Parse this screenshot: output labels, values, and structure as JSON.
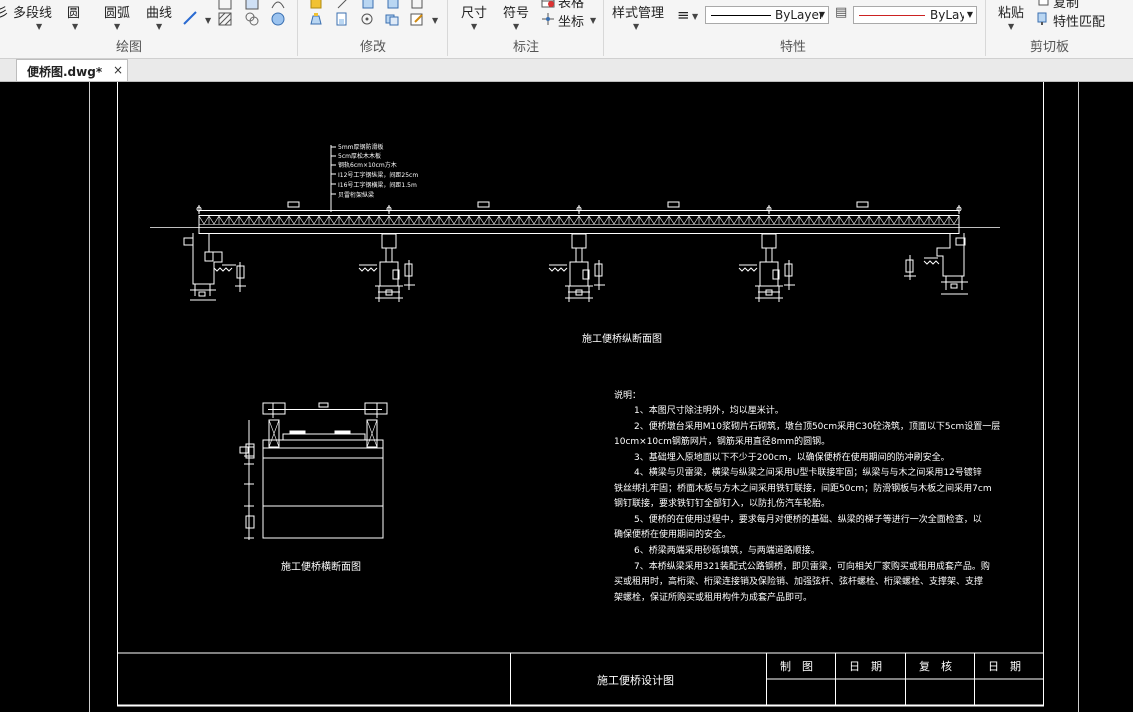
{
  "ribbon": {
    "draw_group": {
      "label": "绘图",
      "partial_char": "彡",
      "polyline": "多段线",
      "circle": "圆",
      "arc": "圆弧",
      "curve": "曲线"
    },
    "modify_group": {
      "label": "修改"
    },
    "annotate_group": {
      "label": "标注",
      "dimension": "尺寸",
      "symbol": "符号",
      "table": "表格",
      "coordinate": "坐标"
    },
    "properties_group": {
      "label": "特性",
      "style_manage": "样式管理",
      "linetype_value": "ByLayer",
      "color_value": "ByLayе",
      "lineweight_color": "#cc2222"
    },
    "clipboard_group": {
      "label": "剪切板",
      "paste": "粘贴",
      "copy": "复制",
      "match_properties": "特性匹配"
    }
  },
  "tabs": [
    {
      "label": "便桥图.dwg*",
      "close": "×"
    }
  ],
  "drawing": {
    "longitudinal_title": "施工便桥纵断面图",
    "cross_title": "施工便桥横断面图",
    "legend_lines": [
      "5mm厚钢防滑板",
      "5cm厚松木木板",
      "钢轨6cm×10cm方木",
      "I12号工字钢纵梁，间距25cm",
      "I16号工字钢横梁，间距1.5m",
      "贝雷桁架纵梁"
    ],
    "notes_title": "说明：",
    "notes": [
      "1、本图尺寸除注明外，均以厘米计。",
      "2、便桥墩台采用M10浆砌片石砌筑，墩台顶50cm采用C30砼浇筑，顶面以下5cm设置一层",
      "10cm×10cm钢筋网片，钢筋采用直径8mm的圆钢。",
      "3、基础埋入原地面以下不少于200cm，以确保便桥在使用期间的防冲刷安全。",
      "4、横梁与贝雷梁，横梁与纵梁之间采用U型卡联接牢固；纵梁与与木之间采用12号镀锌",
      "铁丝绑扎牢固；桥面木板与方木之间采用铁钉联接，间距50cm；防滑钢板与木板之间采用7cm",
      "钢钉联接，要求铁钉钉全部钉入，以防扎伤汽车轮胎。",
      "5、便桥的在使用过程中，要求每月对便桥的基础、纵梁的梯子等进行一次全面检查，以",
      "确保便桥在使用期间的安全。",
      "6、桥梁两端采用砂砾填筑，与两端道路顺接。",
      "7、本桥纵梁采用321装配式公路钢桥，即贝雷梁，可向相关厂家购买或租用成套产品。购",
      "买或租用时，高桁梁、桁梁连接销及保险销、加强弦杆、弦杆螺栓、桁梁螺栓、支撑架、支撑",
      "架螺栓，保证所购买或租用构件为成套产品即可。"
    ],
    "title_block": {
      "drawing_name": "施工便桥设计图",
      "drawn_by": "制　图",
      "date1": "日　期",
      "checked_by": "复　核",
      "date2": "日　期"
    }
  }
}
